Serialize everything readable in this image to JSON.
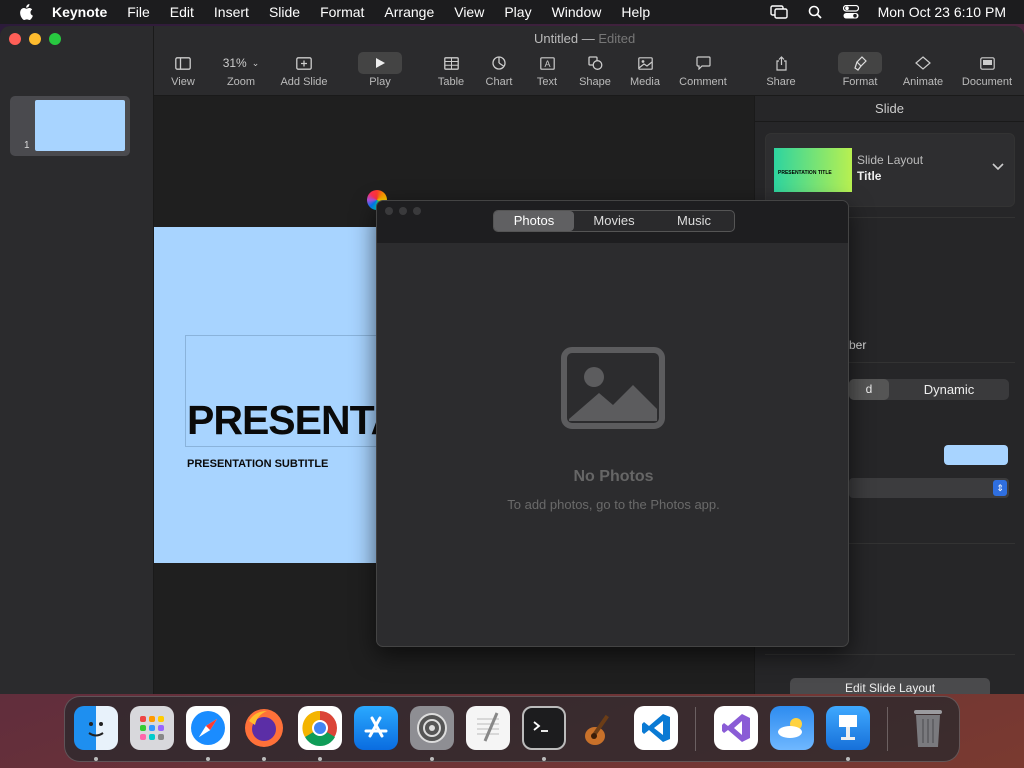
{
  "menubar": {
    "app_name": "Keynote",
    "items": [
      "File",
      "Edit",
      "Insert",
      "Slide",
      "Format",
      "Arrange",
      "View",
      "Play",
      "Window",
      "Help"
    ],
    "clock": "Mon Oct 23  6:10 PM"
  },
  "window": {
    "title": "Untitled",
    "title_sep": " — ",
    "title_status": "Edited"
  },
  "toolbar": {
    "view": "View",
    "zoom_value": "31%",
    "zoom": "Zoom",
    "add_slide": "Add Slide",
    "play": "Play",
    "table": "Table",
    "chart": "Chart",
    "text": "Text",
    "shape": "Shape",
    "media": "Media",
    "comment": "Comment",
    "share": "Share",
    "format": "Format",
    "animate": "Animate",
    "document": "Document"
  },
  "navigator": {
    "slide_number": "1"
  },
  "slide": {
    "title": "PRESENTATION TITLE",
    "subtitle": "PRESENTATION SUBTITLE"
  },
  "inspector": {
    "header": "Slide",
    "layout_label": "Slide Layout",
    "layout_value": "Title",
    "layout_preview_text": "PRESENTATION TITLE",
    "partial_label": "ber",
    "segment_a": "d",
    "segment_b": "Dynamic",
    "fill_color": "#a8d4ff",
    "edit_button": "Edit Slide Layout"
  },
  "media_browser": {
    "tabs": [
      "Photos",
      "Movies",
      "Music"
    ],
    "selected_tab": "Photos",
    "empty_title": "No Photos",
    "empty_hint": "To add photos, go to the Photos app."
  },
  "dock": {
    "apps": [
      "Finder",
      "Launchpad",
      "Safari",
      "Firefox",
      "Chrome",
      "App Store",
      "System Settings",
      "TextEdit",
      "Terminal",
      "GarageBand",
      "Visual Studio Code",
      "Visual Studio",
      "Weather",
      "Keynote",
      "Trash"
    ]
  }
}
